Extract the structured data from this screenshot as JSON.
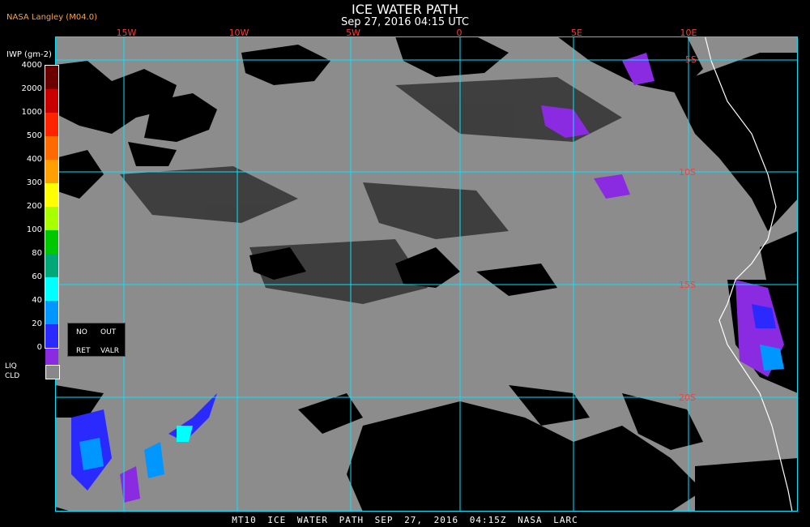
{
  "header": {
    "title": "ICE WATER PATH",
    "subtitle": "Sep 27, 2016 04:15 UTC",
    "source": "NASA Langley (M04.0)"
  },
  "footer": {
    "text": "MT10  ICE WATER PATH  SEP 27, 2016 04:15Z  NASA LARC"
  },
  "map": {
    "lon_labels": [
      "15W",
      "10W",
      "5W",
      "0",
      "5E",
      "10E"
    ],
    "lat_labels": [
      "5S",
      "10S",
      "15S",
      "20S"
    ],
    "colors": {
      "background": "#000000",
      "ocean_gray": "#8c8c8c",
      "grid": "#00e5ff",
      "coastline": "#ffffff",
      "clear_black": "#000000"
    }
  },
  "legend": {
    "title": "IWP (gm-2)",
    "levels": [
      {
        "label": "4000",
        "color": "#6a0000"
      },
      {
        "label": "2000",
        "color": "#c80000"
      },
      {
        "label": "1000",
        "color": "#ff2400"
      },
      {
        "label": "500",
        "color": "#ff6a00"
      },
      {
        "label": "400",
        "color": "#ffa000"
      },
      {
        "label": "300",
        "color": "#ffff00"
      },
      {
        "label": "200",
        "color": "#a8ff00"
      },
      {
        "label": "100",
        "color": "#00c800"
      },
      {
        "label": "80",
        "color": "#00a878"
      },
      {
        "label": "60",
        "color": "#00ffff"
      },
      {
        "label": "40",
        "color": "#0096ff"
      },
      {
        "label": "20",
        "color": "#2a2aff"
      },
      {
        "label": "0",
        "color": "#8a2be2"
      }
    ],
    "no_retrieval": {
      "line1a": "NO",
      "line1b": "OUT",
      "line2a": "RET",
      "line2b": "VALR"
    },
    "liquid_cloud": {
      "line1": "LIQ",
      "line2": "CLD",
      "color": "#888888"
    }
  }
}
